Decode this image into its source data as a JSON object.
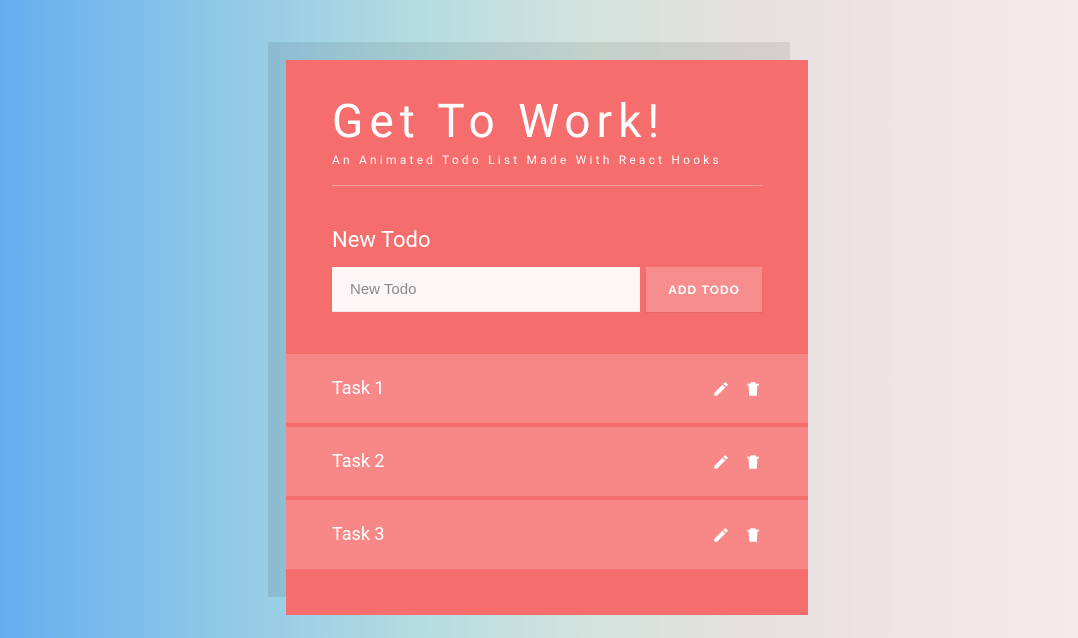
{
  "header": {
    "title": "Get To Work!",
    "subtitle": "An Animated Todo List Made With React Hooks"
  },
  "form": {
    "section_label": "New Todo",
    "input_placeholder": "New Todo",
    "input_value": "",
    "add_button_label": "ADD TODO"
  },
  "todos": [
    {
      "text": "Task 1"
    },
    {
      "text": "Task 2"
    },
    {
      "text": "Task 3"
    }
  ],
  "colors": {
    "card_bg": "#f66d6d",
    "row_bg": "#f88888",
    "button_bg": "#f78d8d",
    "input_bg": "#fdf6f6"
  }
}
